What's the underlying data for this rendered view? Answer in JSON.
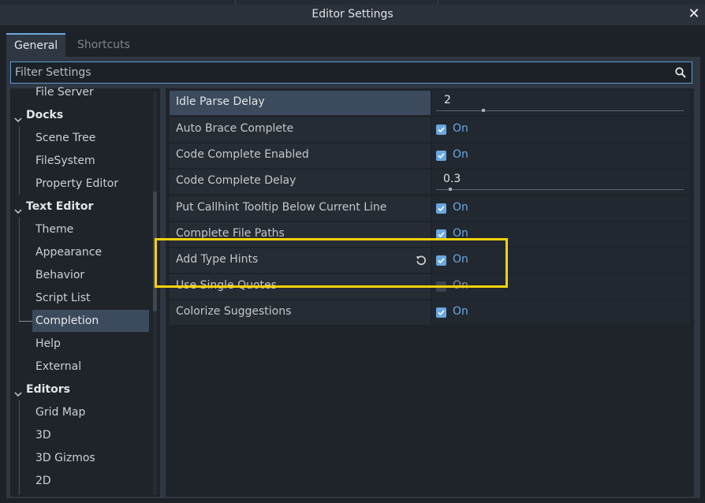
{
  "window": {
    "title": "Editor Settings",
    "close_glyph": "✕"
  },
  "tabs": [
    {
      "label": "General",
      "active": true
    },
    {
      "label": "Shortcuts",
      "active": false
    }
  ],
  "search": {
    "placeholder": "Filter Settings",
    "value": ""
  },
  "tree": {
    "items": [
      {
        "label": "File Server",
        "type": "child"
      },
      {
        "label": "Docks",
        "type": "section"
      },
      {
        "label": "Scene Tree",
        "type": "child"
      },
      {
        "label": "FileSystem",
        "type": "child"
      },
      {
        "label": "Property Editor",
        "type": "child"
      },
      {
        "label": "Text Editor",
        "type": "section"
      },
      {
        "label": "Theme",
        "type": "child"
      },
      {
        "label": "Appearance",
        "type": "child"
      },
      {
        "label": "Behavior",
        "type": "child"
      },
      {
        "label": "Script List",
        "type": "child"
      },
      {
        "label": "Completion",
        "type": "child",
        "selected": true
      },
      {
        "label": "Help",
        "type": "child"
      },
      {
        "label": "External",
        "type": "child"
      },
      {
        "label": "Editors",
        "type": "section"
      },
      {
        "label": "Grid Map",
        "type": "child"
      },
      {
        "label": "3D",
        "type": "child"
      },
      {
        "label": "3D Gizmos",
        "type": "child"
      },
      {
        "label": "2D",
        "type": "child"
      }
    ]
  },
  "properties": [
    {
      "name": "Idle Parse Delay",
      "kind": "number",
      "value": "2",
      "highlighted": true
    },
    {
      "name": "Auto Brace Complete",
      "kind": "bool",
      "checked": true,
      "value": "On"
    },
    {
      "name": "Code Complete Enabled",
      "kind": "bool",
      "checked": true,
      "value": "On"
    },
    {
      "name": "Code Complete Delay",
      "kind": "number",
      "value": "0.3"
    },
    {
      "name": "Put Callhint Tooltip Below Current Line",
      "kind": "bool",
      "checked": true,
      "value": "On"
    },
    {
      "name": "Complete File Paths",
      "kind": "bool",
      "checked": true,
      "value": "On"
    },
    {
      "name": "Add Type Hints",
      "kind": "bool",
      "checked": true,
      "value": "On",
      "revert": true
    },
    {
      "name": "Use Single Quotes",
      "kind": "bool",
      "checked": false,
      "value": "On"
    },
    {
      "name": "Colorize Suggestions",
      "kind": "bool",
      "checked": true,
      "value": "On"
    }
  ],
  "colors": {
    "accent": "#6aa7e0",
    "highlight_box": "#f5d20b",
    "selected": "#3b4a5c"
  }
}
